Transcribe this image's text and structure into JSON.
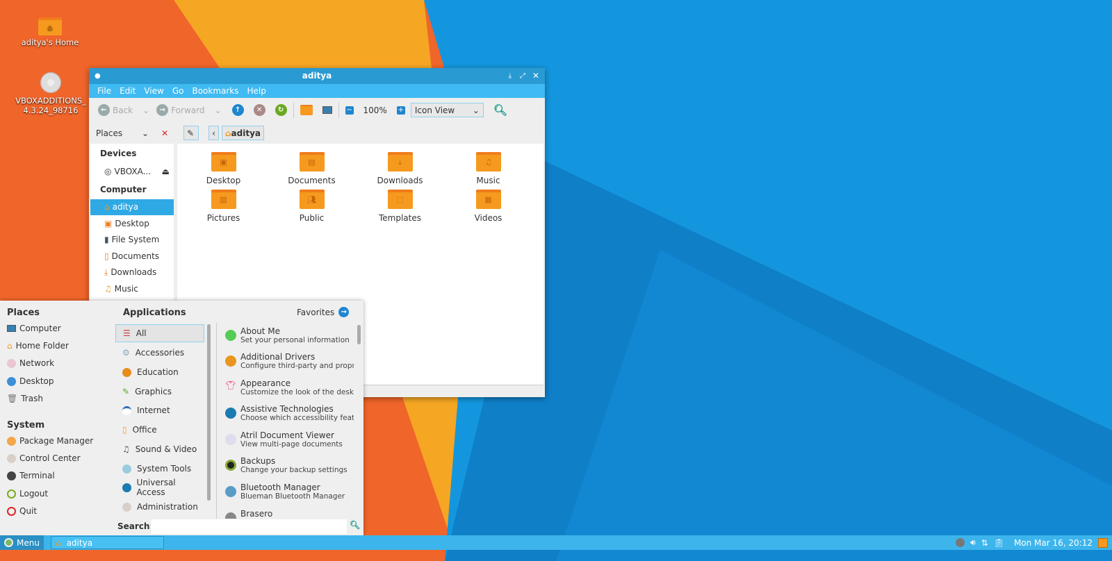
{
  "desktop": {
    "icons": [
      {
        "label": "aditya's Home"
      },
      {
        "label": "VBOXADDITIONS_4.3.24_98716"
      }
    ]
  },
  "window": {
    "title": "aditya",
    "menu": [
      "File",
      "Edit",
      "View",
      "Go",
      "Bookmarks",
      "Help"
    ],
    "toolbar": {
      "back": "Back",
      "forward": "Forward",
      "zoom": "100%",
      "view_mode": "Icon View"
    },
    "location": {
      "pane": "Places",
      "crumb": "aditya"
    },
    "sidebar": {
      "devices_header": "Devices",
      "devices": [
        "VBOXA..."
      ],
      "computer_header": "Computer",
      "items": [
        "aditya",
        "Desktop",
        "File System",
        "Documents",
        "Downloads",
        "Music"
      ],
      "selected": "aditya"
    },
    "files": [
      "Desktop",
      "Documents",
      "Downloads",
      "Music",
      "Pictures",
      "Public",
      "Templates",
      "Videos"
    ]
  },
  "menu": {
    "places_header": "Places",
    "places": [
      "Computer",
      "Home Folder",
      "Network",
      "Desktop",
      "Trash"
    ],
    "system_header": "System",
    "system": [
      "Package Manager",
      "Control Center",
      "Terminal",
      "Logout",
      "Quit"
    ],
    "applications_header": "Applications",
    "favorites": "Favorites",
    "categories": [
      "All",
      "Accessories",
      "Education",
      "Graphics",
      "Internet",
      "Office",
      "Sound & Video",
      "System Tools",
      "Universal Access",
      "Administration"
    ],
    "apps": [
      {
        "name": "About Me",
        "desc": "Set your personal information"
      },
      {
        "name": "Additional Drivers",
        "desc": "Configure third-party and propri..."
      },
      {
        "name": "Appearance",
        "desc": "Customize the look of the desktop"
      },
      {
        "name": "Assistive Technologies",
        "desc": "Choose which accessibility featu..."
      },
      {
        "name": "Atril Document Viewer",
        "desc": "View multi-page documents"
      },
      {
        "name": "Backups",
        "desc": "Change your backup settings"
      },
      {
        "name": "Bluetooth Manager",
        "desc": "Blueman Bluetooth Manager"
      },
      {
        "name": "Brasero",
        "desc": ""
      }
    ],
    "search_label": "Search:",
    "search_value": ""
  },
  "taskbar": {
    "menu": "Menu",
    "task": "aditya",
    "clock": "Mon Mar 16, 20:12"
  },
  "colors": {
    "accent": "#2fa9e4",
    "titlebar": "#2a9ad2",
    "menubar": "#3fbaf2",
    "folder": "#f59a1e"
  }
}
